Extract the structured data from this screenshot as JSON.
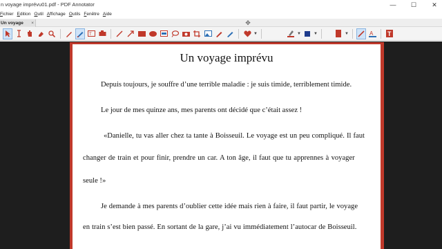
{
  "window": {
    "title": "n voyage imprévu01.pdf - PDF Annotator",
    "minimize": "—",
    "maximize": "☐",
    "close": "✕"
  },
  "menu": [
    "Fichier",
    "Edition",
    "Outil",
    "Affichage",
    "Outils",
    "Fenêtre",
    "Aide"
  ],
  "tab": {
    "label": "Un voyage impr...",
    "close": "×"
  },
  "toolbar": {
    "icons": [
      "select-arrow-icon",
      "text-cursor-icon",
      "hand-icon",
      "eraser-icon",
      "zoom-icon",
      "pen-icon",
      "marker-pen-icon",
      "text-box-icon",
      "stamp-icon",
      "line-icon",
      "arrow-line-icon",
      "rectangle-icon",
      "ellipse-icon",
      "highlight-rect-icon",
      "lasso-icon",
      "camera-icon",
      "crop-icon",
      "insert-image-icon",
      "eraser-tool-icon",
      "heart-icon",
      "line-color-icon",
      "fill-color-icon",
      "page-color-icon",
      "draw-tool-icon",
      "text-tool-icon",
      "text-t-icon"
    ]
  },
  "document": {
    "title": "Un voyage imprévu",
    "lines": [
      "Depuis toujours, je souffre d’une terrible maladie : je suis timide, terriblement timide.",
      "Le jour de mes quinze ans, mes parents ont décidé que c’était assez !",
      "«Danielle, tu vas aller chez ta tante à Boisseuil. Le voyage est un peu compliqué. Il faut",
      "changer de train et pour finir, prendre un car. A ton âge, il faut que tu apprennes à voyager",
      "seule !»",
      "Je demande à mes parents d’oublier cette idée mais rien à faire, il faut partir, le voyage",
      "en train s’est bien passé. En sortant de la gare, j’ai vu immédiatement l’autocar de Boisseuil."
    ]
  },
  "colors": {
    "accent": "#c0392b",
    "workspace": "#1e1e1e"
  }
}
